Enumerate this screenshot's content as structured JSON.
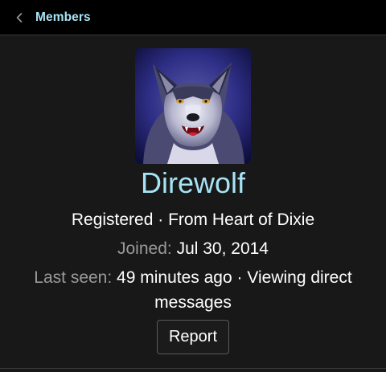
{
  "colors": {
    "background": "#181818",
    "topbar": "#000000",
    "accent": "#a6e3f5",
    "muted_text": "#9a9a9a",
    "text": "#ffffff"
  },
  "nav": {
    "back_icon": "chevron-left-icon",
    "back_label": "Members"
  },
  "profile": {
    "avatar_alt": "wolf-avatar",
    "username": "Direwolf",
    "role": "Registered",
    "separator": "·",
    "location": "From Heart of Dixie",
    "joined_label": "Joined:",
    "joined_value": "Jul 30, 2014",
    "last_seen_label": "Last seen:",
    "last_seen_value": "49 minutes ago",
    "activity": "Viewing direct messages"
  },
  "actions": {
    "report_label": "Report"
  }
}
